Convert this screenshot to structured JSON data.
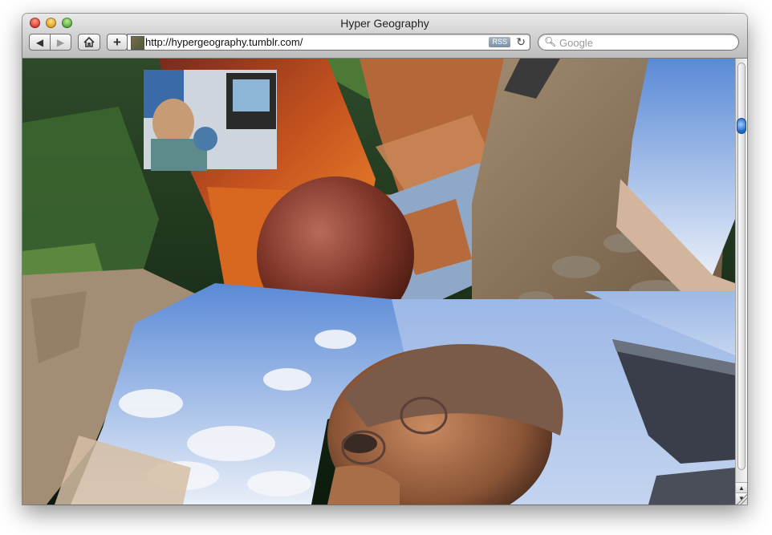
{
  "window": {
    "title": "Hyper Geography"
  },
  "toolbar": {
    "back_icon": "back-arrow-icon",
    "forward_icon": "forward-arrow-icon",
    "home_icon": "home-icon",
    "add_icon": "plus-icon",
    "url": "http://hypergeography.tumblr.com/",
    "rss_label": "RSS",
    "reload_icon": "reload-icon",
    "search_placeholder": "Google"
  },
  "colors": {
    "titlebar": "#d2d2d2",
    "scroll_knob": "#1d64c2",
    "rss_badge": "#8d9db0"
  }
}
